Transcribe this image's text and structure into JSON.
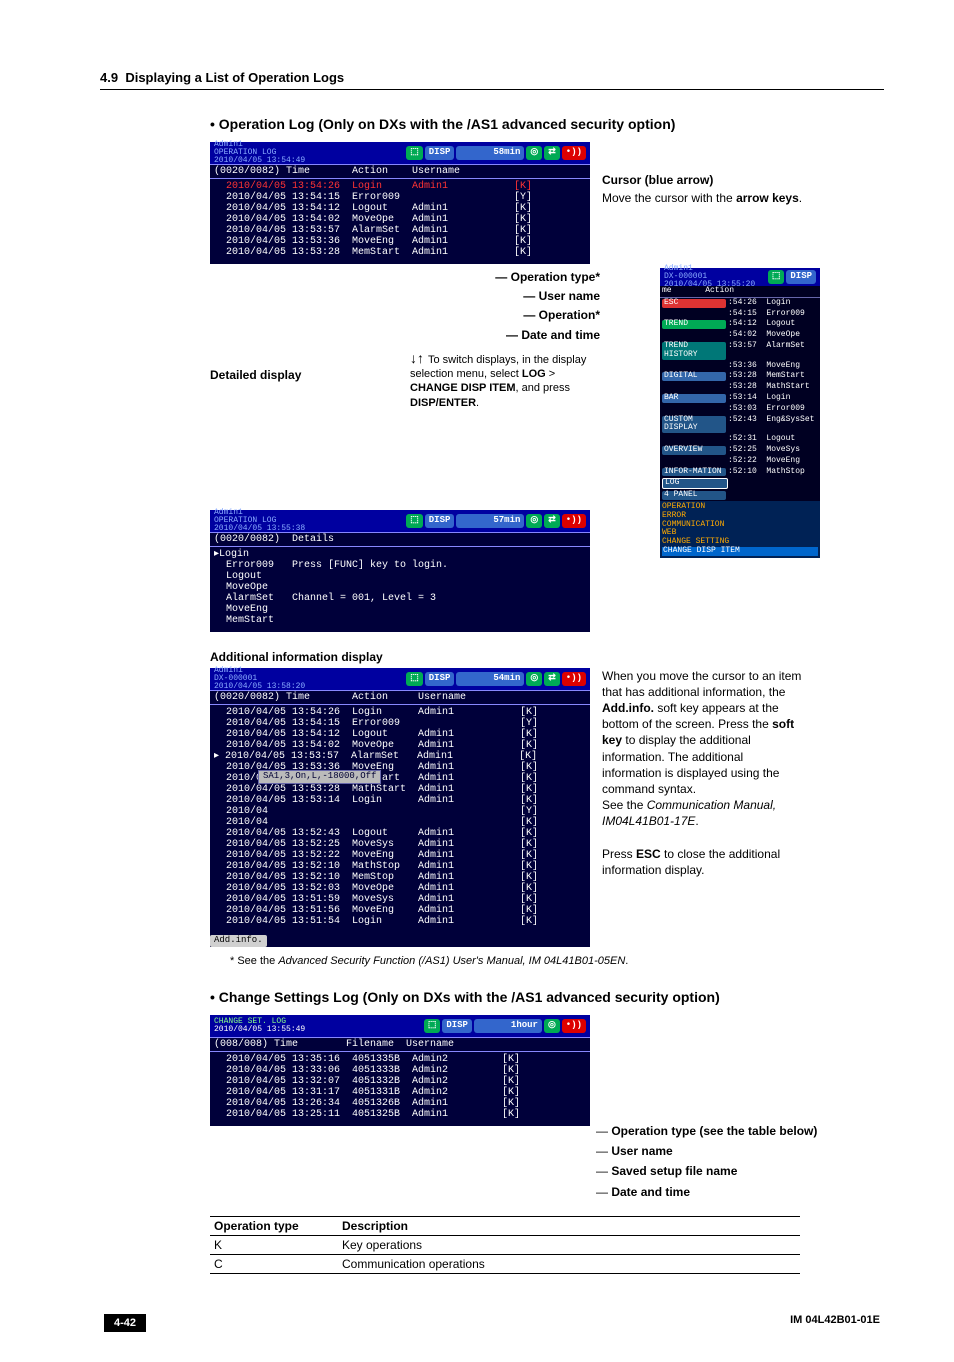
{
  "section_number": "4.9",
  "section_title": "Displaying a List of Operation Logs",
  "bullet1_title": "Operation Log (Only on DXs with the /AS1 advanced security option)",
  "scr1": {
    "title_line1": "Admin1",
    "title_line2": "OPERATION LOG",
    "title_line3": "2010/04/05 13:54:49",
    "disp": "DISP",
    "time": "58min",
    "colhead": "(0020/0082) Time       Action    Username",
    "rows_hl": "  2010/04/05 13:54:26  Login     Admin1           [K]",
    "rows": "  2010/04/05 13:54:15  Error009                   [Y]\n  2010/04/05 13:54:12  Logout    Admin1           [K]\n  2010/04/05 13:54:02  MoveOpe   Admin1           [K]\n  2010/04/05 13:53:57  AlarmSet  Admin1           [K]\n  2010/04/05 13:53:36  MoveEng   Admin1           [K]\n  2010/04/05 13:53:28  MemStart  Admin1           [K]"
  },
  "cursor_box": {
    "title": "Cursor (blue arrow)",
    "text1": "Move the cursor with the ",
    "bold1": "arrow keys",
    "text2": "."
  },
  "callouts1": {
    "a": "Operation type*",
    "b": "User name",
    "c": "Operation*",
    "d": "Date and time"
  },
  "switch_note": {
    "l1": "To switch displays, in the display",
    "l2": "selection menu, select ",
    "b1": "LOG",
    "l3": " >",
    "b2": "CHANGE DISP ITEM",
    "l4": ", and press",
    "b3": "DISP/ENTER",
    "l5": "."
  },
  "detailed_label": "Detailed display",
  "scr2": {
    "title_line1": "Admin1",
    "title_line2": "OPERATION LOG",
    "title_line3": "2010/04/05 13:55:38",
    "disp": "DISP",
    "time": "57min",
    "colhead": "(0020/0082)  Details",
    "rows": "▸Login\n  Error009   Press [FUNC] key to login.\n  Logout\n  MoveOpe\n  AlarmSet   Channel = 001, Level = 3\n  MoveEng\n  MemStart"
  },
  "menu": {
    "title_line1": "Admin1",
    "title_line2": "DX-000001",
    "title_line3": "2010/04/05 13:55:20",
    "disp": "DISP",
    "head": "me       Action",
    "items": [
      {
        "t": "ESC",
        "c": "c-esc",
        "r": ":54:26  Login"
      },
      {
        "t": "",
        "c": "",
        "r": ":54:15  Error009"
      },
      {
        "t": "TREND",
        "c": "c-trend",
        "r": ":54:12  Logout"
      },
      {
        "t": "",
        "c": "",
        "r": ":54:02  MoveOpe"
      },
      {
        "t": "TREND HISTORY",
        "c": "c-hist",
        "r": ":53:57  AlarmSet"
      },
      {
        "t": "",
        "c": "",
        "r": ":53:36  MoveEng"
      },
      {
        "t": "DIGITAL",
        "c": "c-dig",
        "r": ":53:28  MemStart"
      },
      {
        "t": "",
        "c": "",
        "r": ":53:28  MathStart"
      },
      {
        "t": "BAR",
        "c": "c-bar",
        "r": ":53:14  Login"
      },
      {
        "t": "",
        "c": "",
        "r": ":53:03  Error009"
      },
      {
        "t": "CUSTOM DISPLAY",
        "c": "c-cust",
        "r": ":52:43  Eng&SysSet"
      },
      {
        "t": "",
        "c": "",
        "r": ":52:31  Logout"
      },
      {
        "t": "OVERVIEW",
        "c": "c-over",
        "r": ":52:25  MoveSys"
      },
      {
        "t": "",
        "c": "",
        "r": ":52:22  MoveEng"
      },
      {
        "t": "INFOR-MATION",
        "c": "c-info",
        "r": ":52:10  MathStop"
      },
      {
        "t": "LOG",
        "c": "c-log",
        "r": ""
      },
      {
        "t": "4 PANEL",
        "c": "c-pan",
        "r": ""
      }
    ],
    "submenu": [
      "OPERATION",
      "ERROR",
      "COMMUNICATION",
      "WEB",
      "CHANGE SETTING",
      "CHANGE DISP ITEM"
    ]
  },
  "addl_label": "Additional information display",
  "scr3": {
    "title_line1": "Admin1",
    "title_line2": "DX-000001",
    "title_line3": "2010/04/05 13:58:20",
    "disp": "DISP",
    "time": "54min",
    "colhead": "(0020/0082) Time       Action     Username",
    "rows_top": "  2010/04/05 13:54:26  Login      Admin1           [K]\n  2010/04/05 13:54:15  Error009                    [Y]\n  2010/04/05 13:54:12  Logout     Admin1           [K]\n  2010/04/05 13:54:02  MoveOpe    Admin1           [K]\n▸ 2010/04/05 13:53:57  AlarmSet   Admin1           [K]\n  2010/04/05 13:53:36  MoveEng    Admin1           [K]\n  2010/04/05 13:53:28  MemStart   Admin1           [K]\n  2010/04/05 13:53:28  MathStart  Admin1           [K]\n  2010/04/05 13:53:14  Login      Admin1           [K]",
    "tooltip": "SA1,3,On,L,-18000,Off",
    "rows_mid": "  2010/04                                          [Y]\n  2010/04                                          [K]\n  2010/04/05 13:52:43  Logout     Admin1           [K]\n  2010/04/05 13:52:25  MoveSys    Admin1           [K]\n  2010/04/05 13:52:22  MoveEng    Admin1           [K]\n  2010/04/05 13:52:10  MathStop   Admin1           [K]\n  2010/04/05 13:52:10  MemStop    Admin1           [K]\n  2010/04/05 13:52:03  MoveOpe    Admin1           [K]\n  2010/04/05 13:51:59  MoveSys    Admin1           [K]\n  2010/04/05 13:51:56  MoveEng    Admin1           [K]\n  2010/04/05 13:51:54  Login      Admin1           [K]",
    "softkey": "Add.info."
  },
  "addl_side": {
    "p1a": "When you move the cursor to an item that has additional information, the ",
    "p1b": "Add.info.",
    "p1c": " soft key appears at the bottom of the screen. Press the ",
    "p1d": "soft key",
    "p1e": " to display the additional information. The additional information is displayed using the command syntax.",
    "p2a": "See the ",
    "p2b": "Communication Manual, IM04L41B01-17E",
    "p2c": ".",
    "p3a": "Press ",
    "p3b": "ESC",
    "p3c": " to close the additional information display."
  },
  "footnote": "*   See the Advanced Security Function (/AS1) User's Manual, IM 04L41B01-05EN.",
  "footnote_prefix": "*   See the ",
  "footnote_em": "Advanced Security Function (/AS1) User's Manual, IM 04L41B01-05EN",
  "footnote_suffix": ".",
  "bullet2_title": "Change Settings Log (Only on DXs with the /AS1 advanced security option)",
  "scr4": {
    "title_line1": "CHANGE SET. LOG",
    "title_line2": "2010/04/05 13:55:49",
    "disp": "DISP",
    "time": "1hour",
    "colhead": "(008/008) Time        Filename  Username",
    "rows": "  2010/04/05 13:35:16  4051335B  Admin2         [K]\n  2010/04/05 13:33:06  4051333B  Admin2         [K]\n  2010/04/05 13:32:07  4051332B  Admin2         [K]\n  2010/04/05 13:31:17  4051331B  Admin2         [K]\n  2010/04/05 13:26:34  4051326B  Admin1         [K]\n  2010/04/05 13:25:11  4051325B  Admin1         [K]"
  },
  "callouts2": {
    "a": "Operation type (see the table below)",
    "b": "User name",
    "c": "Saved setup file name",
    "d": "Date and time"
  },
  "optable": {
    "h1": "Operation type",
    "h2": "Description",
    "r1a": "K",
    "r1b": "Key operations",
    "r2a": "C",
    "r2b": "Communication operations"
  },
  "footer": {
    "page": "4-42",
    "doc": "IM 04L42B01-01E"
  }
}
